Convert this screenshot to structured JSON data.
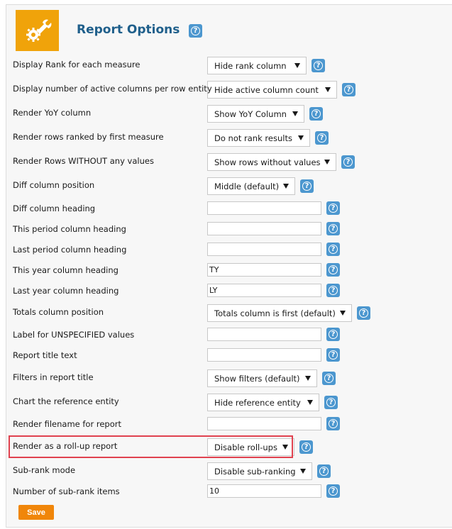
{
  "page": {
    "title": "Report Options",
    "save_label": "Save",
    "accent_color": "#f0a30a",
    "help_icon_color": "#4c97cf",
    "header_icon": "wrench-gear-icon",
    "help_glyph": "?"
  },
  "rows": [
    {
      "label": "Display Rank for each measure",
      "type": "select",
      "value": "Hide rank column"
    },
    {
      "label": "Display number of active columns per row entity",
      "type": "select",
      "value": "Hide active column count"
    },
    {
      "label": "Render YoY column",
      "type": "select",
      "value": "Show YoY Column"
    },
    {
      "label": "Render rows ranked by first measure",
      "type": "select",
      "value": "Do not rank results"
    },
    {
      "label": "Render Rows WITHOUT any values",
      "type": "select",
      "value": "Show rows without values"
    },
    {
      "label": "Diff column position",
      "type": "select",
      "value": "Middle (default)"
    },
    {
      "label": "Diff column heading",
      "type": "input",
      "value": ""
    },
    {
      "label": "This period column heading",
      "type": "input",
      "value": ""
    },
    {
      "label": "Last period column heading",
      "type": "input",
      "value": ""
    },
    {
      "label": "This year column heading",
      "type": "input",
      "value": "TY"
    },
    {
      "label": "Last year column heading",
      "type": "input",
      "value": "LY"
    },
    {
      "label": "Totals column position",
      "type": "select",
      "value": "Totals column is first (default)"
    },
    {
      "label": "Label for UNSPECIFIED values",
      "type": "input",
      "value": ""
    },
    {
      "label": "Report title text",
      "type": "input",
      "value": ""
    },
    {
      "label": "Filters in report title",
      "type": "select",
      "value": "Show filters (default)"
    },
    {
      "label": "Chart the reference entity",
      "type": "select",
      "value": "Hide reference entity"
    },
    {
      "label": "Render filename for report",
      "type": "input",
      "value": ""
    },
    {
      "label": "Render as a roll-up report",
      "type": "select",
      "value": "Disable roll-ups",
      "highlighted": true
    },
    {
      "label": "Sub-rank mode",
      "type": "select",
      "value": "Disable sub-ranking"
    },
    {
      "label": "Number of sub-rank items",
      "type": "input",
      "value": "10"
    }
  ]
}
